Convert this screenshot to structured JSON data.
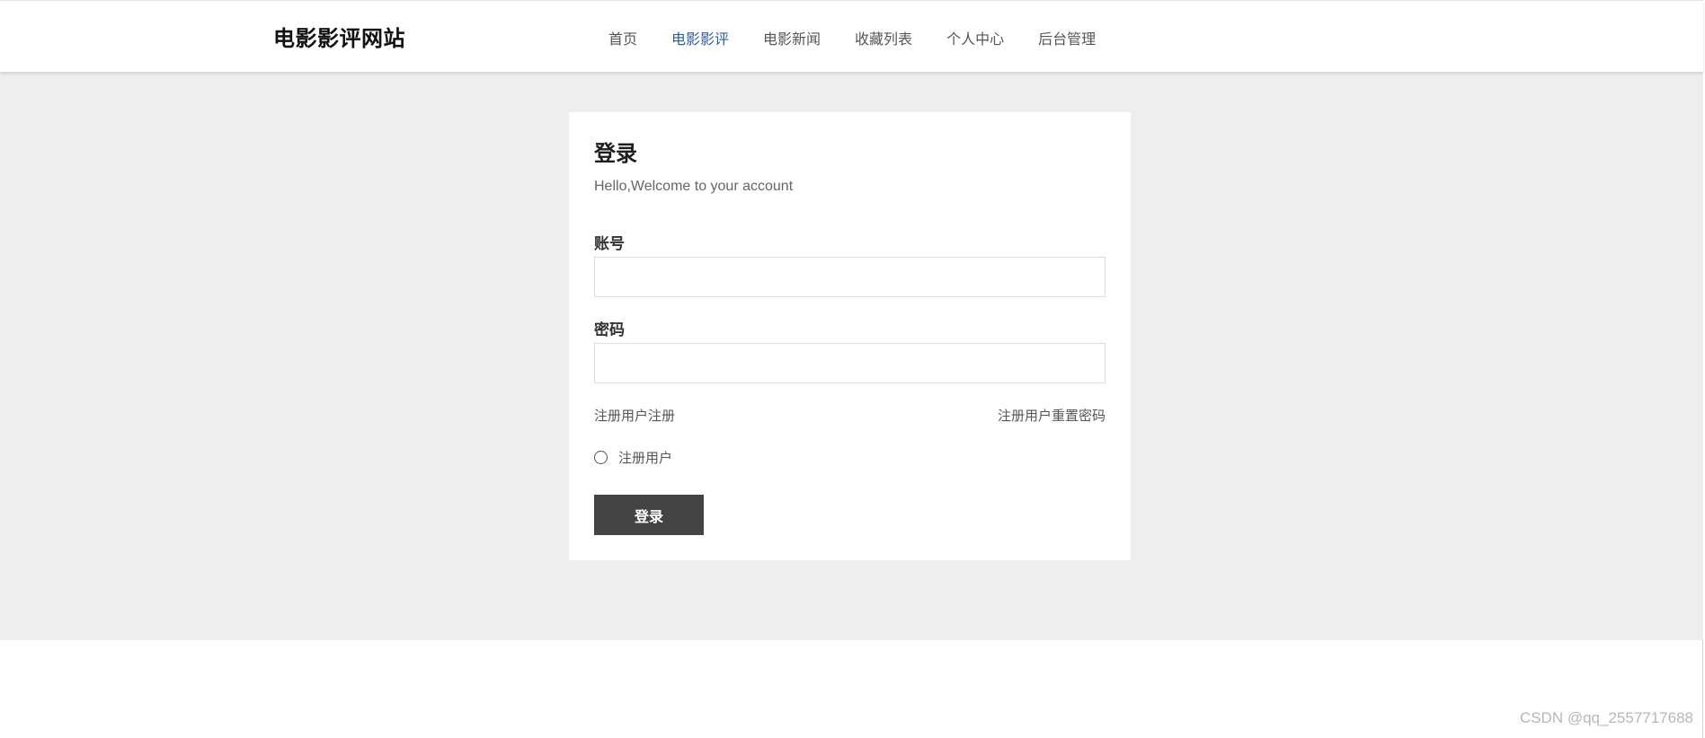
{
  "header": {
    "site_title": "电影影评网站",
    "nav": [
      {
        "label": "首页"
      },
      {
        "label": "电影影评",
        "active": true
      },
      {
        "label": "电影新闻"
      },
      {
        "label": "收藏列表"
      },
      {
        "label": "个人中心"
      },
      {
        "label": "后台管理"
      }
    ],
    "active_color": "#2f5d9a"
  },
  "login": {
    "title": "登录",
    "subtitle": "Hello,Welcome to your account",
    "account_label": "账号",
    "account_value": "",
    "password_label": "密码",
    "password_value": "",
    "register_link": "注册用户注册",
    "reset_link": "注册用户重置密码",
    "role_option": "注册用户",
    "role_selected": false,
    "submit_label": "登录"
  },
  "watermark": "CSDN @qq_2557717688",
  "colors": {
    "band_background": "#eeeeee",
    "button_background": "#444444"
  }
}
